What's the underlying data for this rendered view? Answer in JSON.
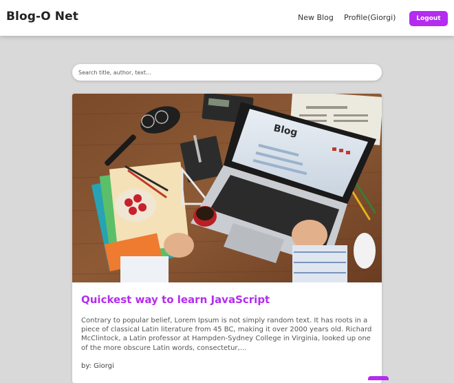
{
  "navbar": {
    "brand": "Blog-O Net",
    "new_blog": "New Blog",
    "profile": "Profile(Giorgi)",
    "logout": "Logout"
  },
  "search": {
    "placeholder": "Search title, author, text..."
  },
  "post": {
    "image_caption": "Blog",
    "title": "Quickest way to learn JavaScript",
    "excerpt": "Contrary to popular belief, Lorem Ipsum is not simply random text. It has roots in a piece of classical Latin literature from 45 BC, making it over 2000 years old. Richard McClintock, a Latin professor at Hampden-Sydney College in Virginia, looked up one of the more obscure Latin words, consectetur,...",
    "author": "by: Giorgi"
  },
  "colors": {
    "accent": "#b32cf0",
    "background": "#d9d9d9"
  }
}
